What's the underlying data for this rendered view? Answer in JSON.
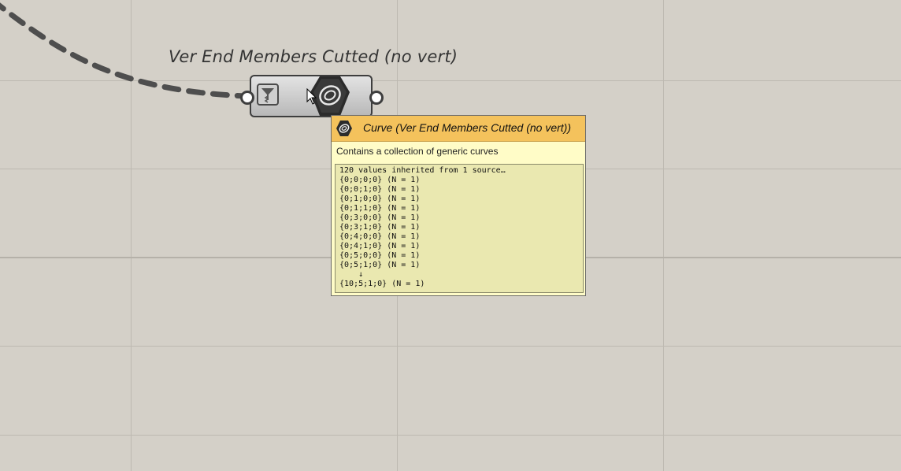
{
  "component": {
    "label": "Ver End Members Cutted (no vert)",
    "param_icon": "funnel-flatten-icon",
    "type_icon": "curve-param-icon"
  },
  "tooltip": {
    "title": "Curve (Ver End Members Cutted (no vert))",
    "description": "Contains a collection of generic curves",
    "lines": [
      "120 values inherited from 1 source…",
      "{0;0;0;0} (N = 1)",
      "{0;0;1;0} (N = 1)",
      "{0;1;0;0} (N = 1)",
      "{0;1;1;0} (N = 1)",
      "{0;3;0;0} (N = 1)",
      "{0;3;1;0} (N = 1)",
      "{0;4;0;0} (N = 1)",
      "{0;4;1;0} (N = 1)",
      "{0;5;0;0} (N = 1)",
      "{0;5;1;0} (N = 1)",
      "    ↓",
      "{10;5;1;0} (N = 1)"
    ]
  },
  "colors": {
    "canvas": "#d4d0c8",
    "tooltip_header": "#f4c25c",
    "tooltip_body": "#fffcc7",
    "data_box": "#eae8b0"
  }
}
